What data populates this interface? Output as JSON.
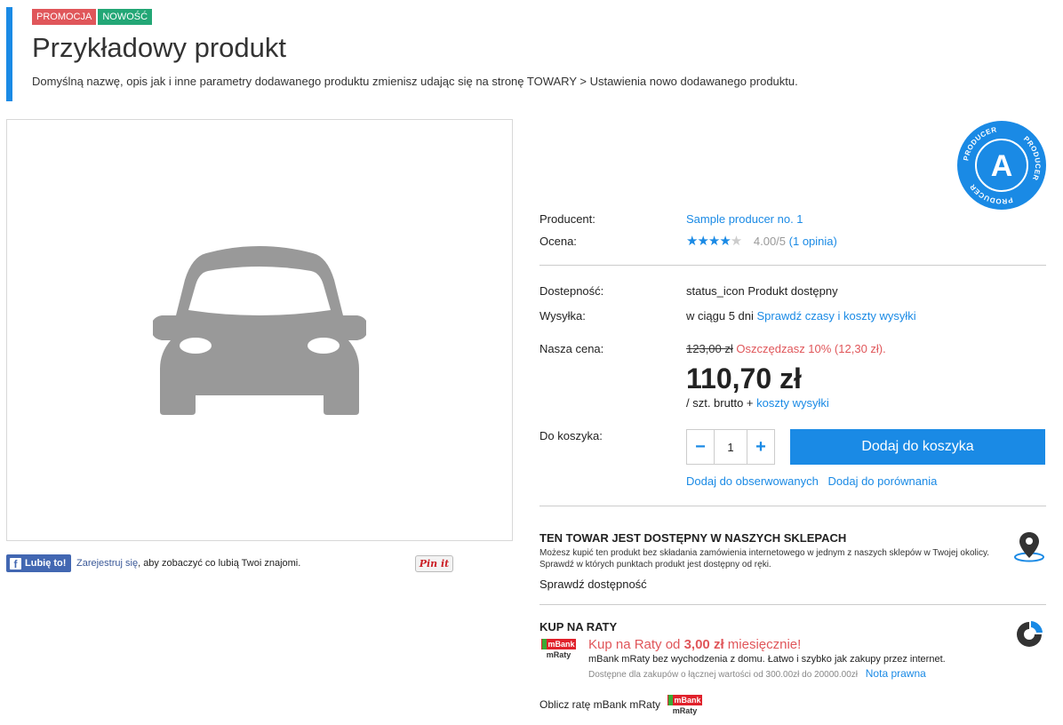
{
  "header": {
    "badges": [
      "PROMOCJA",
      "NOWOŚĆ"
    ],
    "title": "Przykładowy produkt",
    "description": "Domyślną nazwę, opis jak i inne parametry dodawanego produktu zmienisz udając się na stronę TOWARY > Ustawienia nowo dodawanego produktu."
  },
  "social": {
    "like_label": "Lubię to!",
    "register_link": "Zarejestruj się",
    "register_rest": ", aby zobaczyć co lubią Twoi znajomi.",
    "pin_label": "Pin it"
  },
  "producer_logo": {
    "ring_text": "PRODUCER",
    "letter": "A"
  },
  "details": {
    "producer_label": "Producent:",
    "producer_value": "Sample producer no. 1",
    "rating_label": "Ocena:",
    "rating_value": 4,
    "rating_max": 5,
    "rating_score": "4.00/5",
    "rating_reviews": "(1 opinia)",
    "availability_label": "Dostepność:",
    "availability_icon": "status_icon",
    "availability_value": "Produkt dostępny",
    "shipping_label": "Wysyłka:",
    "shipping_value": "w ciągu 5 dni",
    "shipping_link": "Sprawdź czasy i koszty wysyłki",
    "price_label": "Nasza cena:",
    "old_price": "123,00 zł",
    "savings": "Oszczędzasz 10% (12,30 zł).",
    "price": "110,70 zł",
    "unit": "/ szt. brutto +",
    "shipping_cost_link": "koszty wysyłki",
    "cart_label": "Do koszyka:",
    "quantity": "1",
    "minus": "−",
    "plus": "+",
    "add_to_cart": "Dodaj do koszyka",
    "watch_link": "Dodaj do obserwowanych",
    "compare_link": "Dodaj do porównania"
  },
  "stores": {
    "title": "TEN TOWAR JEST DOSTĘPNY W NASZYCH SKLEPACH",
    "text": "Możesz kupić ten produkt bez składania zamówienia internetowego w jednym z naszych sklepów w Twojej okolicy. Sprawdź w których punktach produkt jest dostępny od ręki.",
    "link": "Sprawdź dostępność"
  },
  "installments": {
    "title": "KUP NA RATY",
    "headline_pre": "Kup na Raty od",
    "headline_amount": "3,00 zł",
    "headline_post": "miesięcznie!",
    "desc": "mBank mRaty bez wychodzenia z domu. Łatwo i szybko jak zakupy przez internet.",
    "note": "Dostępne dla zakupów o łącznej wartości od 300.00zł do 20000.00zł",
    "legal_link": "Nota prawna",
    "calc_link": "Oblicz ratę mBank mRaty",
    "logo_top": "mBank",
    "logo_bottom": "mRaty"
  }
}
